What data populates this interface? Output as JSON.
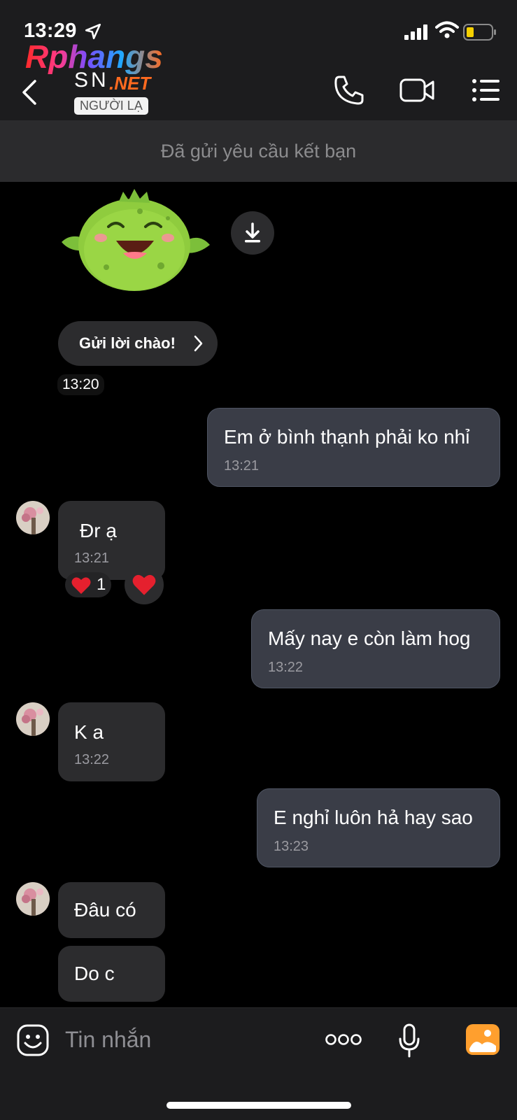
{
  "status_bar": {
    "time": "13:29"
  },
  "header": {
    "logo_main": "Rphangs",
    "logo_sn": "SN",
    "logo_net": ".NET",
    "badge": "NGƯỜI LẠ"
  },
  "friend_request_bar": {
    "text": "Đã gửi yêu cầu kết bạn"
  },
  "greeting": {
    "button_label": "Gửi lời chào!",
    "time": "13:20"
  },
  "messages": [
    {
      "side": "sent",
      "text": "Em ở bình thạnh phải ko nhỉ",
      "time": "13:21"
    },
    {
      "side": "received",
      "text": "Đr ạ",
      "time": "13:21",
      "reaction_count": "1"
    },
    {
      "side": "sent",
      "text": "Mấy nay e còn làm hog",
      "time": "13:22"
    },
    {
      "side": "received",
      "text": "K a",
      "time": "13:22"
    },
    {
      "side": "sent",
      "text": "E nghỉ luôn hả hay sao",
      "time": "13:23"
    },
    {
      "side": "received",
      "text": "Đâu có"
    },
    {
      "side": "received",
      "text": "Do c"
    }
  ],
  "composer": {
    "placeholder": "Tin nhắn"
  },
  "colors": {
    "sent_bubble": "#3a3d47",
    "received_bubble": "#2c2c2e",
    "accent": "#ff9f2e",
    "heart": "#e5202e"
  },
  "icons": [
    "location-arrow-icon",
    "signal-icon",
    "wifi-icon",
    "battery-icon",
    "back-chevron-icon",
    "phone-icon",
    "video-camera-icon",
    "menu-list-icon",
    "download-icon",
    "chevron-right-icon",
    "heart-icon",
    "emoji-icon",
    "more-dots-icon",
    "microphone-icon",
    "gallery-icon"
  ]
}
